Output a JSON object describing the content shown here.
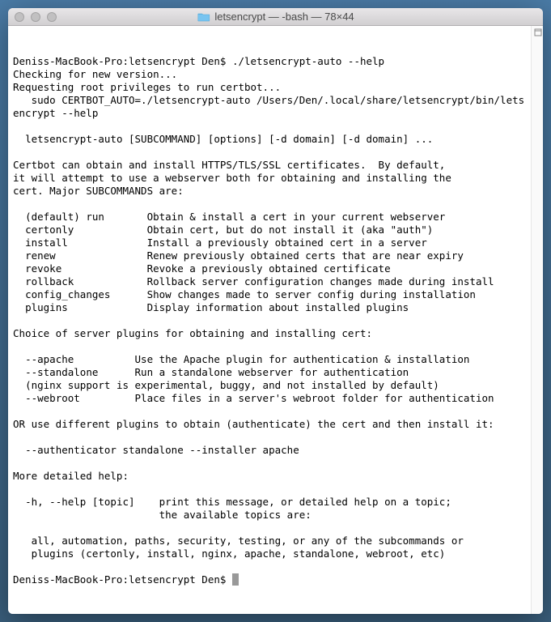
{
  "window": {
    "title": "letsencrypt — -bash — 78×44"
  },
  "terminal": {
    "prompt1_host": "Deniss-MacBook-Pro:letsencrypt Den$ ",
    "prompt1_cmd": "./letsencrypt-auto --help",
    "lines": [
      "Checking for new version...",
      "Requesting root privileges to run certbot...",
      "   sudo CERTBOT_AUTO=./letsencrypt-auto /Users/Den/.local/share/letsencrypt/bin/letsencrypt --help",
      "",
      "  letsencrypt-auto [SUBCOMMAND] [options] [-d domain] [-d domain] ...",
      "",
      "Certbot can obtain and install HTTPS/TLS/SSL certificates.  By default,",
      "it will attempt to use a webserver both for obtaining and installing the",
      "cert. Major SUBCOMMANDS are:",
      "",
      "  (default) run       Obtain & install a cert in your current webserver",
      "  certonly            Obtain cert, but do not install it (aka \"auth\")",
      "  install             Install a previously obtained cert in a server",
      "  renew               Renew previously obtained certs that are near expiry",
      "  revoke              Revoke a previously obtained certificate",
      "  rollback            Rollback server configuration changes made during install",
      "  config_changes      Show changes made to server config during installation",
      "  plugins             Display information about installed plugins",
      "",
      "Choice of server plugins for obtaining and installing cert:",
      "",
      "  --apache          Use the Apache plugin for authentication & installation",
      "  --standalone      Run a standalone webserver for authentication",
      "  (nginx support is experimental, buggy, and not installed by default)",
      "  --webroot         Place files in a server's webroot folder for authentication",
      "",
      "OR use different plugins to obtain (authenticate) the cert and then install it:",
      "",
      "  --authenticator standalone --installer apache",
      "",
      "More detailed help:",
      "",
      "  -h, --help [topic]    print this message, or detailed help on a topic;",
      "                        the available topics are:",
      "",
      "   all, automation, paths, security, testing, or any of the subcommands or",
      "   plugins (certonly, install, nginx, apache, standalone, webroot, etc)",
      ""
    ],
    "prompt2_host": "Deniss-MacBook-Pro:letsencrypt Den$ "
  }
}
